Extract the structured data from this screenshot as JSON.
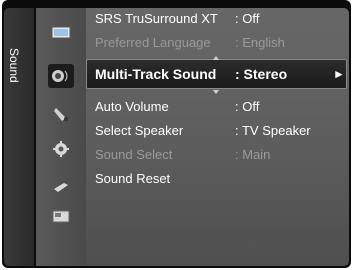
{
  "side_tab": {
    "label": "Sound"
  },
  "sidebar_icons": [
    "picture-icon",
    "sound-icon",
    "channel-icon",
    "setup-icon",
    "input-icon",
    "application-icon"
  ],
  "menu": {
    "items": [
      {
        "label": "SRS TruSurround XT",
        "value": ": Off",
        "enabled": true
      },
      {
        "label": "Preferred Language",
        "value": ": English",
        "enabled": false
      },
      {
        "label": "Multi-Track Sound",
        "value": ": Stereo",
        "enabled": true,
        "selected": true,
        "arrow": "►"
      },
      {
        "label": "Auto Volume",
        "value": ": Off",
        "enabled": true
      },
      {
        "label": "Select Speaker",
        "value": ": TV Speaker",
        "enabled": true
      },
      {
        "label": "Sound Select",
        "value": ": Main",
        "enabled": false
      },
      {
        "label": "Sound Reset",
        "value": "",
        "enabled": true
      }
    ]
  }
}
